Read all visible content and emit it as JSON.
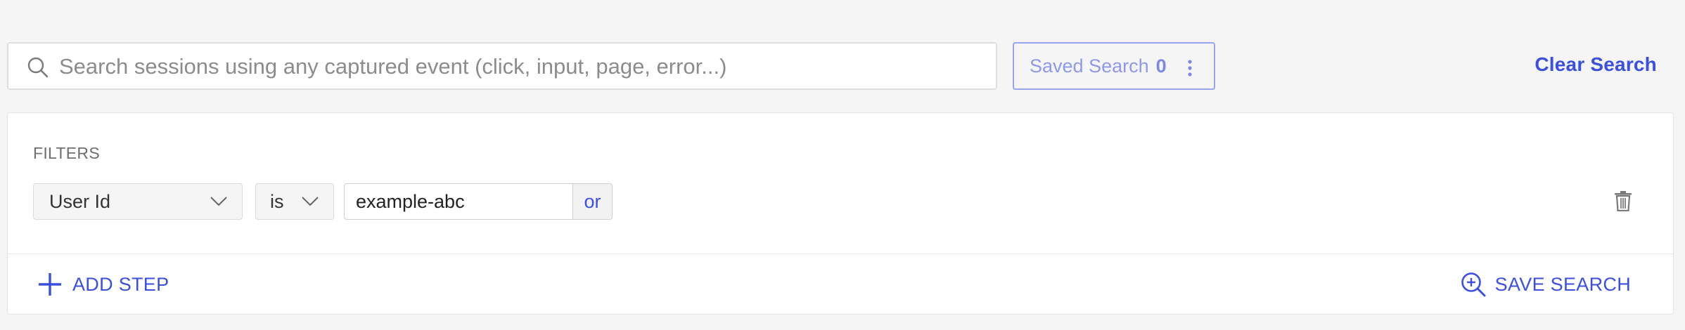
{
  "search": {
    "placeholder": "Search sessions using any captured event (click, input, page, error...)",
    "icon": "search-icon"
  },
  "saved_search": {
    "label": "Saved Search",
    "count": "0",
    "menu_icon": "kebab-icon"
  },
  "clear_search_label": "Clear Search",
  "filters": {
    "label": "FILTERS",
    "rows": [
      {
        "field": "User Id",
        "operator": "is",
        "value": "example-abc",
        "or_label": "or"
      }
    ]
  },
  "add_step_label": "ADD STEP",
  "save_search_label": "SAVE SEARCH",
  "colors": {
    "accent": "#3b4fe0",
    "saved_search_border": "#98a3f2",
    "background": "#f5f5f5"
  }
}
